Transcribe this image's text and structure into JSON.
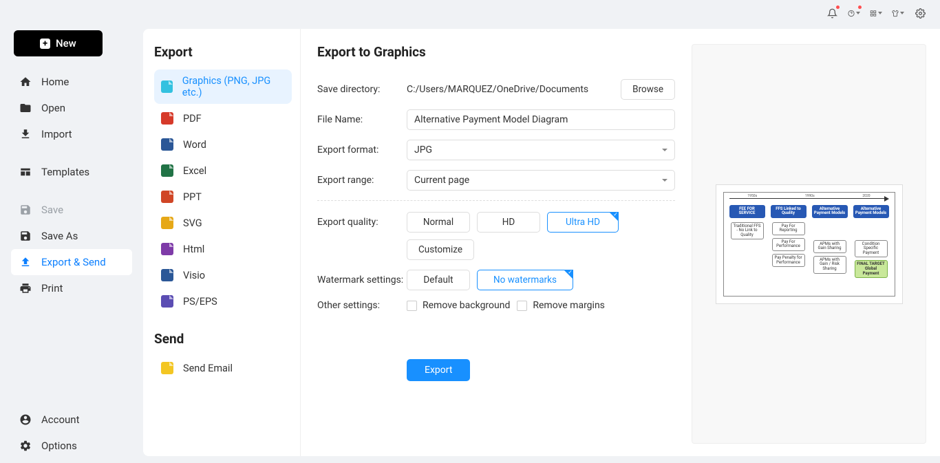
{
  "topbar": {
    "icons": [
      "bell-icon",
      "help-icon",
      "apps-icon",
      "shirt-icon",
      "gear-icon"
    ]
  },
  "newButton": "New",
  "sidebar": [
    {
      "key": "home",
      "label": "Home",
      "icon": "home-icon"
    },
    {
      "key": "open",
      "label": "Open",
      "icon": "folder-icon"
    },
    {
      "key": "import",
      "label": "Import",
      "icon": "import-icon"
    },
    {
      "key": "sep"
    },
    {
      "key": "templates",
      "label": "Templates",
      "icon": "templates-icon"
    },
    {
      "key": "sep"
    },
    {
      "key": "save",
      "label": "Save",
      "icon": "save-icon",
      "disabled": true
    },
    {
      "key": "saveas",
      "label": "Save As",
      "icon": "saveas-icon"
    },
    {
      "key": "export",
      "label": "Export & Send",
      "icon": "export-icon",
      "active": true
    },
    {
      "key": "print",
      "label": "Print",
      "icon": "print-icon"
    }
  ],
  "sidebarBottom": [
    {
      "key": "account",
      "label": "Account",
      "icon": "account-icon"
    },
    {
      "key": "options",
      "label": "Options",
      "icon": "options-icon"
    }
  ],
  "exportHeading": "Export",
  "exportFormats": [
    {
      "key": "graphics",
      "label": "Graphics (PNG, JPG etc.)",
      "color": "#33c1e0",
      "active": true
    },
    {
      "key": "pdf",
      "label": "PDF",
      "color": "#d63a2a"
    },
    {
      "key": "word",
      "label": "Word",
      "color": "#2b5797"
    },
    {
      "key": "excel",
      "label": "Excel",
      "color": "#217346"
    },
    {
      "key": "ppt",
      "label": "PPT",
      "color": "#d04626"
    },
    {
      "key": "svg",
      "label": "SVG",
      "color": "#e6a817"
    },
    {
      "key": "html",
      "label": "Html",
      "color": "#7e3ba8"
    },
    {
      "key": "visio",
      "label": "Visio",
      "color": "#2b5797"
    },
    {
      "key": "pseps",
      "label": "PS/EPS",
      "color": "#5b4db3"
    }
  ],
  "sendHeading": "Send",
  "sendItems": [
    {
      "key": "email",
      "label": "Send Email",
      "color": "#f3c623"
    }
  ],
  "form": {
    "title": "Export to Graphics",
    "saveDirLabel": "Save directory:",
    "saveDir": "C:/Users/MARQUEZ/OneDrive/Documents",
    "browse": "Browse",
    "fileNameLabel": "File Name:",
    "fileName": "Alternative Payment Model Diagram",
    "formatLabel": "Export format:",
    "format": "JPG",
    "rangeLabel": "Export range:",
    "range": "Current page",
    "qualityLabel": "Export quality:",
    "qualityOptions": [
      "Normal",
      "HD",
      "Ultra HD"
    ],
    "qualitySelected": "Ultra HD",
    "customize": "Customize",
    "watermarkLabel": "Watermark settings:",
    "watermarkOptions": [
      "Default",
      "No watermarks"
    ],
    "watermarkSelected": "No watermarks",
    "otherLabel": "Other settings:",
    "removeBg": "Remove background",
    "removeMargins": "Remove margins",
    "exportBtn": "Export"
  },
  "preview": {
    "scaleLabels": [
      "1950s",
      "1990s",
      "2020"
    ],
    "headers": [
      "FEE FOR SERVICE",
      "FFS Linked to Quality",
      "Alternative Payment Models",
      "Alternative Payment Models"
    ],
    "col1": [
      "Traditional FFS - No Link to Quality"
    ],
    "col2": [
      "Pay For Reporting",
      "Pay For Performance",
      "Pay Penalty for Performance"
    ],
    "col3": [
      "APMs with Gain Sharing",
      "APMs with Gain / Risk Sharing"
    ],
    "col4": [
      "Condition Specific Payment",
      "FINAL TARGET Global Payment"
    ]
  }
}
